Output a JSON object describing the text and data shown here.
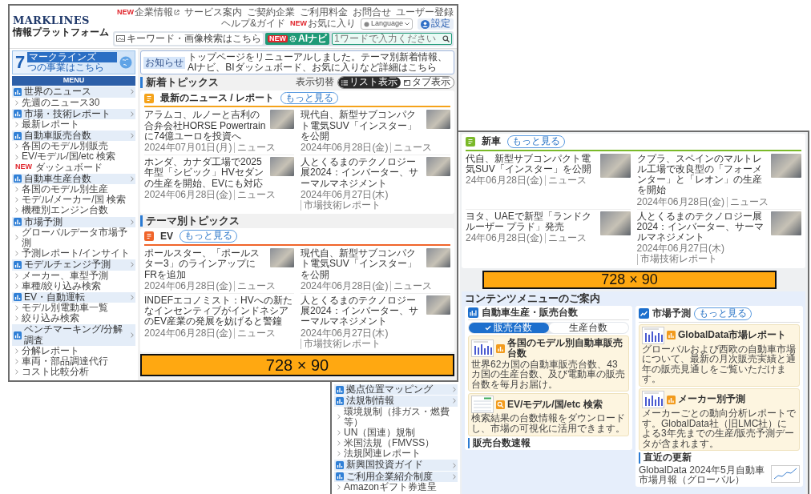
{
  "front_window": {
    "header": {
      "top_links": [
        {
          "badge": "NEW",
          "label": "企業情報",
          "external": true
        },
        {
          "label": "サービス案内"
        },
        {
          "label": "ご契約企業"
        },
        {
          "label": "ご利用料金"
        },
        {
          "label": "お問合せ"
        },
        {
          "label": "ユーザー登録"
        },
        {
          "label": "ヘルプ&ガイド"
        },
        {
          "badge": "NEW",
          "label": "お気に入り"
        }
      ],
      "language": "Language",
      "logo": "MARKLINES",
      "logo_subtitle": "情報プラットフォーム",
      "keyword_button": "キーワード・画像検索はこちら",
      "ai_navi": {
        "badge": "NEW",
        "label": "AIナビ"
      },
      "search": {
        "placeholder": "1ワードで入力ください"
      },
      "account_label": "設定"
    },
    "banner": {
      "number": "7",
      "tag": "マークラインズ",
      "text": "つの事業はこちら"
    },
    "menu": {
      "title": "MENU",
      "items": [
        {
          "kind": "category",
          "label": "世界のニュース"
        },
        {
          "kind": "link",
          "label": "先週のニュース30"
        },
        {
          "kind": "category",
          "label": "市場・技術レポート"
        },
        {
          "kind": "link",
          "label": "最新レポート"
        },
        {
          "kind": "category",
          "label": "自動車販売台数"
        },
        {
          "kind": "link",
          "label": "各国のモデル別販売"
        },
        {
          "kind": "link",
          "label": "EV/モデル/国/etc 検索"
        },
        {
          "kind": "link",
          "badge": "NEW",
          "label": "ダッシュボード"
        },
        {
          "kind": "category",
          "label": "自動車生産台数"
        },
        {
          "kind": "link",
          "label": "各国のモデル別生産"
        },
        {
          "kind": "link",
          "label": "モデル/メーカー/国 検索"
        },
        {
          "kind": "link",
          "label": "機種別エンジン台数"
        },
        {
          "kind": "category",
          "label": "市場予測"
        },
        {
          "kind": "link",
          "label": "グローバルデータ市場予測"
        },
        {
          "kind": "link",
          "label": "予測レポート/インサイト"
        },
        {
          "kind": "category",
          "label": "モデルチェンジ予測"
        },
        {
          "kind": "link",
          "label": "メーカー、車型予測"
        },
        {
          "kind": "link",
          "label": "車種/絞り込み検索"
        },
        {
          "kind": "category",
          "label": "EV・自動運転"
        },
        {
          "kind": "link",
          "label": "モデル別電動車一覧"
        },
        {
          "kind": "link",
          "label": "絞り込み検索"
        },
        {
          "kind": "category",
          "label": "ベンチマーキング/分解調査"
        },
        {
          "kind": "link",
          "label": "分解レポート"
        },
        {
          "kind": "link",
          "label": "車両・部品調達代行"
        },
        {
          "kind": "link",
          "label": "コスト比較分析"
        }
      ]
    },
    "notice": {
      "tag": "お知らせ",
      "text": "トップページをリニューアルしました。テーマ別新着情報、AIナビ、BIダッシュボード、お気に入りなど詳細はこちら"
    },
    "sections": [
      {
        "heading": "新着トピックス",
        "view_switch": {
          "label": "表示切替",
          "options": [
            {
              "label": "リスト表示",
              "selected": true
            },
            {
              "label": "タブ表示",
              "selected": false
            }
          ]
        },
        "cards": [
          {
            "title": "最新のニュース / レポート",
            "color": "#f5a31a",
            "more": "もっと見る",
            "articles": [
              {
                "title": "アラムコ、ルノーと吉利の合弁会社HORSE Powertrainに74億ユーロを投資へ",
                "date": "2024年07月01日(月)",
                "category": "ニュース",
                "photo": true
              },
              {
                "title": "現代自、新型サブコンパクト電気SUV「インスター」を公開",
                "date": "2024年06月28日(金)",
                "category": "ニュース",
                "photo": true
              },
              {
                "title": "ホンダ、カナダ工場で2025年型「シビック」HVセダンの生産を開始、EVにも対応",
                "date": "2024年06月28日(金)",
                "category": "ニュース",
                "photo": true
              },
              {
                "title": "人とくるまのテクノロジー展2024：インバーター、サーマルマネジメント",
                "date": "2024年06月27日(木)",
                "category": "市場技術レポート",
                "photo": true
              }
            ]
          }
        ]
      },
      {
        "heading": "テーマ別トピックス",
        "cards": [
          {
            "title": "EV",
            "color": "#f0642a",
            "more": "もっと見る",
            "articles": [
              {
                "title": "ポールスター、「ポールスター3」のラインアップにFRを追加",
                "date": "2024年06月28日(金)",
                "category": "ニュース",
                "photo": true
              },
              {
                "title": "現代自、新型サブコンパクト電気SUV「インスター」を公開",
                "date": "2024年06月28日(金)",
                "category": "ニュース",
                "photo": true
              },
              {
                "title": "INDEFエコノミスト：HVへの新たなインセンティブがインドネシアのEV産業の発展を妨げると警鐘",
                "date": "2024年06月28日(金)",
                "category": "ニュース",
                "photo": false
              },
              {
                "title": "人とくるまのテクノロジー展2024：インバーター、サーマルマネジメント",
                "date": "2024年06月27日(木)",
                "category": "市場技術レポート",
                "photo": true
              }
            ]
          }
        ]
      }
    ],
    "ad": "728 × 90"
  },
  "back_window": {
    "menu": {
      "items": [
        {
          "kind": "category",
          "label": "拠点位置マッピング"
        },
        {
          "kind": "category",
          "label": "法規制情報"
        },
        {
          "kind": "link",
          "label": "環境規制（排ガス・燃費等）"
        },
        {
          "kind": "link",
          "label": "UN（国連）規制"
        },
        {
          "kind": "link",
          "label": "米国法規（FMVSS）"
        },
        {
          "kind": "link",
          "label": "法規関連レポート"
        },
        {
          "kind": "category",
          "label": "新興国投資ガイド"
        },
        {
          "kind": "category",
          "label": "ご利用企業紹介制度"
        },
        {
          "kind": "link",
          "label": "Amazonギフト券進呈"
        }
      ]
    },
    "card": {
      "title": "新車",
      "color": "#7ab929",
      "more": "もっと見る",
      "articles": [
        {
          "title": "代自、新型サブコンパクト電気SUV「インスター」を公開",
          "date": "24年06月28日(金)",
          "category": "ニュース",
          "photo": true
        },
        {
          "title": "クプラ、スペインのマルトレル工場で改良型の「フォーメンター」と「レオン」の生産を開始",
          "date": "2024年06月28日(金)",
          "category": "ニュース",
          "photo": true
        },
        {
          "title": "ヨタ、UAEで新型「ランドクルーザー プラド」発売",
          "date": "24年06月28日(金)",
          "category": "ニュース",
          "photo": true
        },
        {
          "title": "人とくるまのテクノロジー展2024：インバーター、サーマルマネジメント",
          "date": "2024年06月27日(木)",
          "category": "市場技術レポート",
          "photo": true
        }
      ]
    },
    "ad": "728 × 90",
    "content_menu": {
      "title": "コンテンツメニューのご案内",
      "panels": [
        {
          "kind": "bars",
          "title": "自動車生産・販売台数",
          "toggle": [
            {
              "label": "販売台数",
              "selected": true
            },
            {
              "label": "生産台数",
              "selected": false
            }
          ],
          "items": [
            {
              "kind": "chart",
              "title": "各国のモデル別自動車販売台数",
              "description": "世界62カ国の自動車販売台数、43カ国の生産台数、及び電動車の販売台数を毎月お届け。"
            },
            {
              "kind": "search",
              "title": "EV/モデル/国/etc 検索",
              "description": "検索結果の台数情報をダウンロードし、市場の可視化に活用できます。"
            }
          ],
          "subheading": "販売台数速報"
        },
        {
          "kind": "trend",
          "title": "市場予測",
          "more": "もっと見る",
          "items": [
            {
              "kind": "chart",
              "title": "GlobalData市場レポート",
              "description": "グローバルおよび西欧の自動車市場について、最新の月次販売実績と通年の販売見通しをご覧いただけます。"
            },
            {
              "kind": "chart",
              "title": "メーカー別予測",
              "description": "メーカーごとの動向分析レポートです。GlobalData社（旧LMC社）による3年先までの生産/販売予測データが含まれます。"
            }
          ],
          "subheading": "直近の更新",
          "updates": [
            {
              "title": "GlobalData 2024年5月自動車市場月報（グローバル）"
            }
          ]
        }
      ]
    }
  }
}
